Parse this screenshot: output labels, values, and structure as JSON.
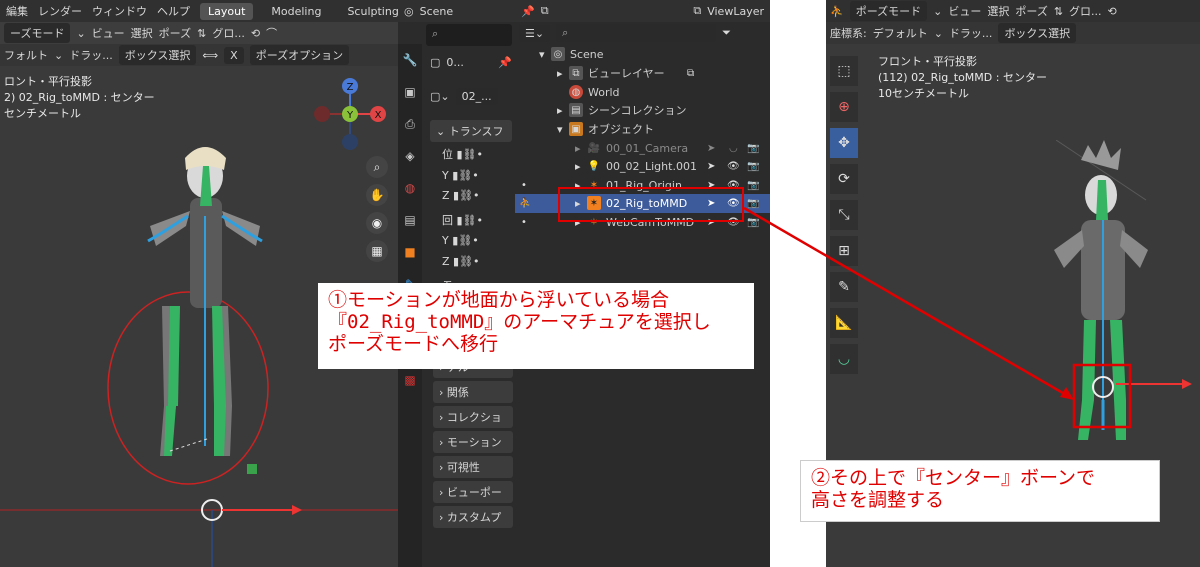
{
  "left_view": {
    "menu": [
      "編集",
      "レンダー",
      "ウィンドウ",
      "ヘルプ"
    ],
    "workspace_tabs": [
      "Layout",
      "Modeling",
      "Sculpting"
    ],
    "mode_label": "ーズモード",
    "header_items": [
      "ビュー",
      "選択",
      "ポーズ"
    ],
    "transform_label": "グロ...",
    "row2": {
      "default_label": "フォルト",
      "drag_label": "ドラッ...",
      "select_label": "ボックス選択",
      "x_label": "X",
      "pose_options_label": "ポーズオプション"
    },
    "overlay": [
      "ロント・平行投影",
      "2) 02_Rig_toMMD : センター",
      "センチメートル"
    ],
    "gizmo_axes": {
      "z": "Z",
      "y": "Y",
      "x": "X"
    }
  },
  "properties": {
    "scene_label": "Scene",
    "object_label": "0...",
    "data_label": "02_...",
    "section_transform": "トランスフ",
    "fields": [
      "位",
      "Y",
      "Z",
      "回",
      "Y",
      "Z",
      "モ"
    ],
    "sections": [
      "ナルー",
      "関係",
      "コレクショ",
      "モーション",
      "可視性",
      "ビューポー",
      "カスタムプ"
    ]
  },
  "outliner": {
    "view_layer_label": "ViewLayer",
    "items": [
      {
        "label": "Scene",
        "color": "#cfcfcf"
      },
      {
        "label": "ビューレイヤー",
        "color": "#cfcfcf"
      },
      {
        "label": "World",
        "color": "#cfcfcf"
      },
      {
        "label": "シーンコレクション",
        "color": "#cfcfcf"
      },
      {
        "label": "オブジェクト",
        "color": "#cfcfcf"
      },
      {
        "label": "00_01_Camera",
        "color": "#8a8a8a"
      },
      {
        "label": "00_02_Light.001",
        "color": "#cfcfcf"
      },
      {
        "label": "01_Rig_Origin",
        "color": "#cfcfcf"
      },
      {
        "label": "02_Rig_toMMD",
        "color": "#ffffff"
      },
      {
        "label": "WebCamToMMD",
        "color": "#cfcfcf"
      }
    ]
  },
  "right_view": {
    "mode_label": "ポーズモード",
    "header_items": [
      "ビュー",
      "選択",
      "ポーズ"
    ],
    "transform_label": "グロ...",
    "row2": {
      "coord_label": "座標系:",
      "default_label": "デフォルト",
      "drag_label": "ドラッ...",
      "select_label": "ボックス選択"
    },
    "overlay": [
      "フロント・平行投影",
      "(112) 02_Rig_toMMD : センター",
      "10センチメートル"
    ]
  },
  "annotations": {
    "note1": [
      "①モーションが地面から浮いている場合",
      "『02_Rig_toMMD』のアーマチュアを選択し",
      "ポーズモードへ移行"
    ],
    "note2": [
      "②その上で『センター』ボーンで",
      "高さを調整する"
    ],
    "accent": "#e00000"
  }
}
